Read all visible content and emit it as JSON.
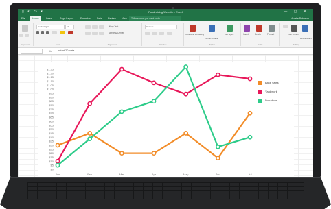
{
  "window": {
    "title": "Fundraising Website - Excel",
    "qat": "▯ ↶ ↷ ▾",
    "controls": "— ▢ ✕"
  },
  "ribbon": {
    "tabs": [
      "File",
      "Home",
      "Insert",
      "Page Layout",
      "Formulas",
      "Data",
      "Review",
      "View"
    ],
    "tell_me": "Tell me what you want to do",
    "sign_in": "Aurelie Robinson",
    "font_name": "Calibri Light",
    "font_size": "10",
    "wrap_text": "Wrap Text",
    "merge": "Merge & Center",
    "number_format": "Custom",
    "conditional_formatting": "Conditional Formatting",
    "format_as_table": "Format as Table",
    "cell_styles": "Cell Styles",
    "insert": "Insert",
    "delete": "Delete",
    "format": "Format",
    "sort_filter": "Sort & Filter",
    "find_select": "Find & Select",
    "groups": [
      "Clipboard",
      "Font",
      "Alignment",
      "Number",
      "Styles",
      "Cells",
      "Editing"
    ]
  },
  "formula_bar": {
    "name_box": "",
    "fx": "fx",
    "formula": "Instant 2D scale"
  },
  "colors": {
    "excel_green": "#217346",
    "bake_sales": "#f28c28",
    "yard_work": "#e8185a",
    "donations": "#2ecc8a"
  },
  "chart_data": {
    "type": "line",
    "categories": [
      "Jan",
      "Feb",
      "Mar",
      "Apr",
      "May",
      "Jun",
      "Jul"
    ],
    "y_ticks": [
      "$0",
      "$5",
      "$10",
      "$15",
      "$20",
      "$25",
      "$30",
      "$35",
      "$40",
      "$45",
      "$50",
      "$55",
      "$60",
      "$65",
      "$70",
      "$75",
      "$80",
      "$85",
      "$90",
      "$95",
      "$1.00",
      "$1.05",
      "$1.10",
      "$1.15",
      "$1.20",
      "$1.25"
    ],
    "ylim": [
      0,
      125
    ],
    "series": [
      {
        "name": "Bake sales",
        "color": "#f28c28",
        "values": [
          30,
          45,
          20,
          20,
          45,
          14,
          70
        ]
      },
      {
        "name": "Yard work",
        "color": "#e8185a",
        "values": [
          10,
          82,
          125,
          108,
          94,
          118,
          113
        ]
      },
      {
        "name": "Donations",
        "color": "#2ecc8a",
        "values": [
          5,
          38,
          72,
          85,
          128,
          28,
          40
        ]
      }
    ],
    "legend_position": "right",
    "grid": false
  }
}
